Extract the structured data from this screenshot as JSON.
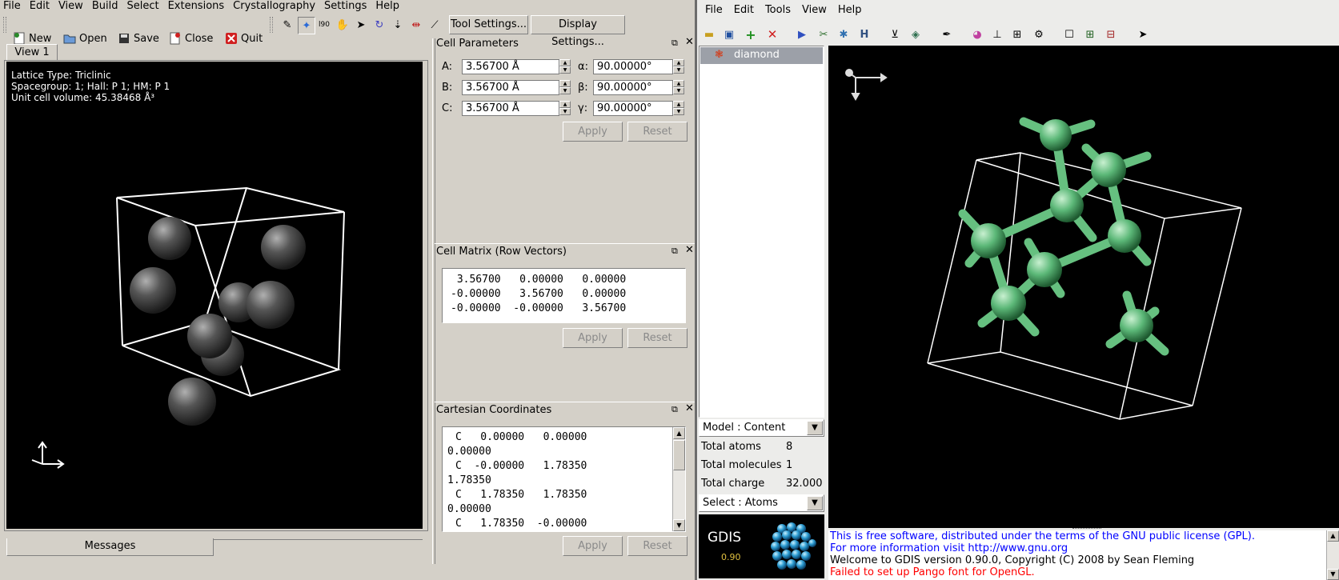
{
  "left_app": {
    "menu": [
      "File",
      "Edit",
      "View",
      "Build",
      "Select",
      "Extensions",
      "Crystallography",
      "Settings",
      "Help"
    ],
    "toolbar": {
      "new": "New",
      "open": "Open",
      "save": "Save",
      "close": "Close",
      "quit": "Quit",
      "tool_settings": "Tool Settings...",
      "display_settings": "Display Settings..."
    },
    "view_tab": "View 1",
    "overlay": {
      "line1": "Lattice Type: Triclinic",
      "line2": "Spacegroup: 1; Hall: P 1; HM: P 1",
      "line3": "Unit cell volume: 45.38468 Å³"
    },
    "messages_tab": "Messages"
  },
  "cell_parameters": {
    "title": "Cell Parameters",
    "a_label": "A:",
    "a_value": "3.56700 Å",
    "b_label": "B:",
    "b_value": "3.56700 Å",
    "c_label": "C:",
    "c_value": "3.56700 Å",
    "alpha_label": "α:",
    "alpha_value": "90.00000°",
    "beta_label": "β:",
    "beta_value": "90.00000°",
    "gamma_label": "γ:",
    "gamma_value": "90.00000°",
    "apply": "Apply",
    "reset": "Reset"
  },
  "cell_matrix": {
    "title": "Cell Matrix (Row Vectors)",
    "rows": [
      " 3.56700   0.00000   0.00000",
      "-0.00000   3.56700   0.00000",
      "-0.00000  -0.00000   3.56700"
    ],
    "apply": "Apply",
    "reset": "Reset"
  },
  "cartesian": {
    "title": "Cartesian Coordinates",
    "lines": [
      "C   0.00000   0.00000",
      "0.00000",
      "C  -0.00000   1.78350",
      "1.78350",
      "C   1.78350   1.78350",
      "0.00000",
      "C   1.78350  -0.00000"
    ],
    "apply": "Apply",
    "reset": "Reset"
  },
  "gdis": {
    "menu": [
      "File",
      "Edit",
      "Tools",
      "View",
      "Help"
    ],
    "model_name": "diamond",
    "model_select": "Model : Content",
    "stats": [
      {
        "label": "Total atoms",
        "value": "8"
      },
      {
        "label": "Total molecules",
        "value": "1"
      },
      {
        "label": "Total charge",
        "value": "32.000"
      }
    ],
    "select_mode": "Select : Atoms",
    "logo_title": "GDIS",
    "logo_version": "0.90",
    "messages": [
      {
        "text": "This is free software, distributed under the terms of the GNU public license (GPL).",
        "color": "#0000ff"
      },
      {
        "text": "For more information visit http://www.gnu.org",
        "color": "#0000ff"
      },
      {
        "text": "Welcome to GDIS version 0.90.0, Copyright (C) 2008 by Sean Fleming",
        "color": "#000000"
      },
      {
        "text": "Failed to set up Pango font for OpenGL.",
        "color": "#ff0000"
      }
    ]
  }
}
